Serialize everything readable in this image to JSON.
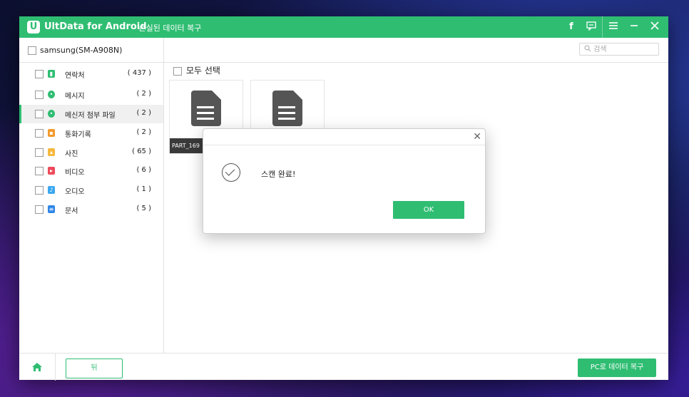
{
  "app": {
    "logo_letter": "U",
    "title": "UltData for Android",
    "subtitle": "- 손실된 데이터 복구",
    "brand_color": "#2fbd72"
  },
  "titlebar_icons": [
    "facebook-icon",
    "feedback-icon",
    "menu-icon",
    "minimize-icon",
    "close-icon"
  ],
  "device": {
    "name": "samsung(SM-A908N)"
  },
  "search": {
    "placeholder": "검색"
  },
  "categories": [
    {
      "label": "연락처",
      "count": "( 437 )",
      "icon": "contacts-icon",
      "color": "#2fbd72"
    },
    {
      "label": "메시지",
      "count": "( 2 )",
      "icon": "messages-icon",
      "color": "#2fbd72"
    },
    {
      "label": "메신저 첨부 파일",
      "count": "( 2 )",
      "icon": "attachments-icon",
      "color": "#2fbd72",
      "selected": true
    },
    {
      "label": "통화기록",
      "count": "( 2 )",
      "icon": "call-log-icon",
      "color": "#f39a2b"
    },
    {
      "label": "사진",
      "count": "( 65 )",
      "icon": "photos-icon",
      "color": "#f5b83d"
    },
    {
      "label": "비디오",
      "count": "( 6 )",
      "icon": "video-icon",
      "color": "#ef4a5a"
    },
    {
      "label": "오디오",
      "count": "( 1 )",
      "icon": "audio-icon",
      "color": "#3ba7f0"
    },
    {
      "label": "문서",
      "count": "( 5 )",
      "icon": "documents-icon",
      "color": "#2f86e8"
    }
  ],
  "main": {
    "select_all": "모두 선택",
    "files": [
      {
        "name": "PART_169"
      },
      {
        "name": ""
      }
    ]
  },
  "dialog": {
    "message": "스캔 완료!",
    "ok": "OK",
    "close": "✕"
  },
  "footer": {
    "back": "뒤",
    "recover": "PC로 데이터 복구"
  }
}
